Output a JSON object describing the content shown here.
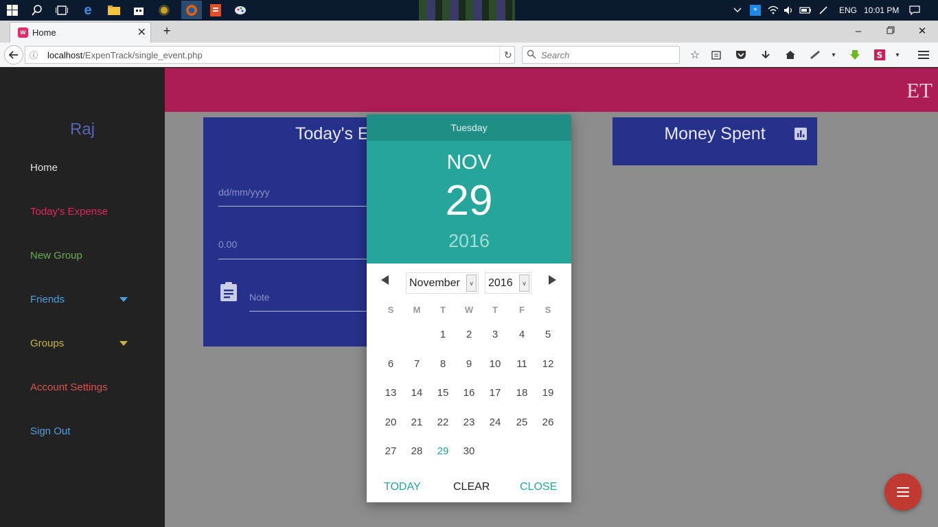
{
  "taskbar": {
    "tray_language": "ENG",
    "tray_time": "10:01 PM"
  },
  "browser": {
    "tab_title": "Home",
    "url_host": "localhost",
    "url_path": "/ExpenTrack/single_event.php",
    "search_placeholder": "Search"
  },
  "app": {
    "brand": "ET",
    "user_name": "Raj",
    "menu": [
      {
        "label": "Home",
        "color": "#e0e0e0"
      },
      {
        "label": "Today's Expense",
        "color": "#e0265f"
      },
      {
        "label": "New Group",
        "color": "#6aad4a"
      },
      {
        "label": "Friends",
        "color": "#4aa3df"
      },
      {
        "label": "Groups",
        "color": "#cdb33a"
      },
      {
        "label": "Account Settings",
        "color": "#d9534f"
      },
      {
        "label": "Sign Out",
        "color": "#4aa3df"
      }
    ]
  },
  "expense_card": {
    "title": "Today's E",
    "date_placeholder": "dd/mm/yyyy",
    "amount_placeholder": "0.00",
    "note_placeholder": "Note"
  },
  "money_card": {
    "title": "Money Spent"
  },
  "datepicker": {
    "weekday": "Tuesday",
    "month_abbr": "NOV",
    "day": "29",
    "year": "2016",
    "month_select": "November",
    "year_select": "2016",
    "weekday_headers": [
      "S",
      "M",
      "T",
      "W",
      "T",
      "F",
      "S"
    ],
    "weeks": [
      [
        "",
        "",
        "1",
        "2",
        "3",
        "4",
        "5"
      ],
      [
        "6",
        "7",
        "8",
        "9",
        "10",
        "11",
        "12"
      ],
      [
        "13",
        "14",
        "15",
        "16",
        "17",
        "18",
        "19"
      ],
      [
        "20",
        "21",
        "22",
        "23",
        "24",
        "25",
        "26"
      ],
      [
        "27",
        "28",
        "29",
        "30",
        "",
        "",
        ""
      ]
    ],
    "selected_day": "29",
    "today_label": "TODAY",
    "clear_label": "CLEAR",
    "close_label": "CLOSE",
    "accent": "#26a69a"
  }
}
